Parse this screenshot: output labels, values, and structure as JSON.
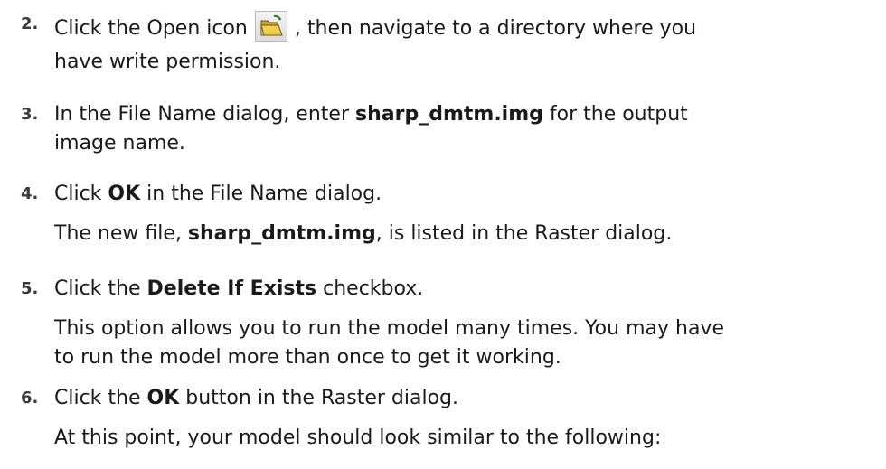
{
  "steps": [
    {
      "number": "2.",
      "lines": [
        {
          "before_icon": "Click the Open icon",
          "after_icon": ", then navigate to a directory where you"
        },
        {
          "text": "have write permission."
        }
      ],
      "icon": "open-folder-icon"
    },
    {
      "number": "3.",
      "line1_a": "In the File Name dialog, enter ",
      "line1_b": "sharp_dmtm.img",
      "line1_c": " for the output",
      "line2": "image name."
    },
    {
      "number": "4.",
      "line1_a": "Click ",
      "line1_b": "OK",
      "line1_c": " in the File Name dialog.",
      "line2_a": "The new file, ",
      "line2_b": "sharp_dmtm.img",
      "line2_c": ", is listed in the Raster dialog."
    },
    {
      "number": "5.",
      "line1_a": "Click the ",
      "line1_b": "Delete If Exists",
      "line1_c": " checkbox.",
      "line2": "This option allows you to run the model many times. You may have",
      "line3": "to run the model more than once to get it working."
    },
    {
      "number": "6.",
      "line1_a": "Click the ",
      "line1_b": "OK",
      "line1_c": " button in the Raster dialog.",
      "line2": "At this point, your model should look similar to the following:"
    }
  ]
}
